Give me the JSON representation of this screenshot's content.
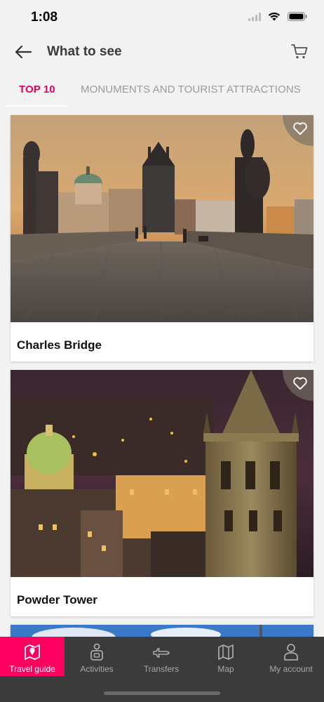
{
  "status": {
    "time": "1:08"
  },
  "header": {
    "title": "What to see",
    "back_icon": "arrow-left-icon",
    "cart_icon": "cart-icon"
  },
  "tabs": [
    {
      "label": "TOP 10",
      "active": true
    },
    {
      "label": "MONUMENTS AND TOURIST ATTRACTIONS",
      "active": false
    }
  ],
  "cards": [
    {
      "title": "Charles Bridge",
      "favorite_icon": "heart-icon"
    },
    {
      "title": "Powder Tower",
      "favorite_icon": "heart-icon"
    }
  ],
  "bottom_nav": [
    {
      "label": "Travel guide",
      "icon": "map-marker-icon",
      "active": true
    },
    {
      "label": "Activities",
      "icon": "activities-icon",
      "active": false
    },
    {
      "label": "Transfers",
      "icon": "airplane-icon",
      "active": false
    },
    {
      "label": "Map",
      "icon": "map-icon",
      "active": false
    },
    {
      "label": "My account",
      "icon": "person-icon",
      "active": false
    }
  ],
  "colors": {
    "accent": "#ff0060",
    "tab_active": "#e6005c",
    "nav_bg": "#3b3b3b"
  }
}
